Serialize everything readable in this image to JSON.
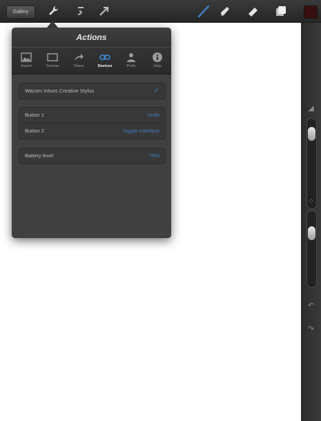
{
  "toolbar": {
    "gallery_label": "Gallery",
    "icons": [
      "actions-wrench-icon",
      "adjustments-icon",
      "transform-arrow-icon",
      "brush-icon",
      "smudge-icon",
      "eraser-icon",
      "layers-icon"
    ],
    "color_swatch": "#3a0f0f"
  },
  "panel": {
    "title": "Actions",
    "tabs": [
      {
        "label": "Import",
        "icon": "image-icon",
        "active": false
      },
      {
        "label": "Canvas",
        "icon": "canvas-icon",
        "active": false
      },
      {
        "label": "Share",
        "icon": "share-arrow-icon",
        "active": false
      },
      {
        "label": "Devices",
        "icon": "devices-link-icon",
        "active": true
      },
      {
        "label": "Prefs",
        "icon": "person-icon",
        "active": false
      },
      {
        "label": "Help",
        "icon": "info-icon",
        "active": false
      }
    ],
    "stylus": {
      "name": "Wacom Intuos Creative Stylus",
      "connected": true
    },
    "buttons": [
      {
        "label": "Button 1",
        "value": "Undo"
      },
      {
        "label": "Button 2",
        "value": "Toggle Interface"
      }
    ],
    "battery": {
      "label": "Battery level",
      "value": "75%"
    }
  },
  "sidebar": {
    "icons": [
      "brush-size-icon",
      "opacity-square-icon",
      "undo-icon",
      "redo-icon"
    ]
  },
  "colors": {
    "accent": "#3f7fc6",
    "toolbar": "#2e2e2e",
    "panel": "#444444"
  }
}
